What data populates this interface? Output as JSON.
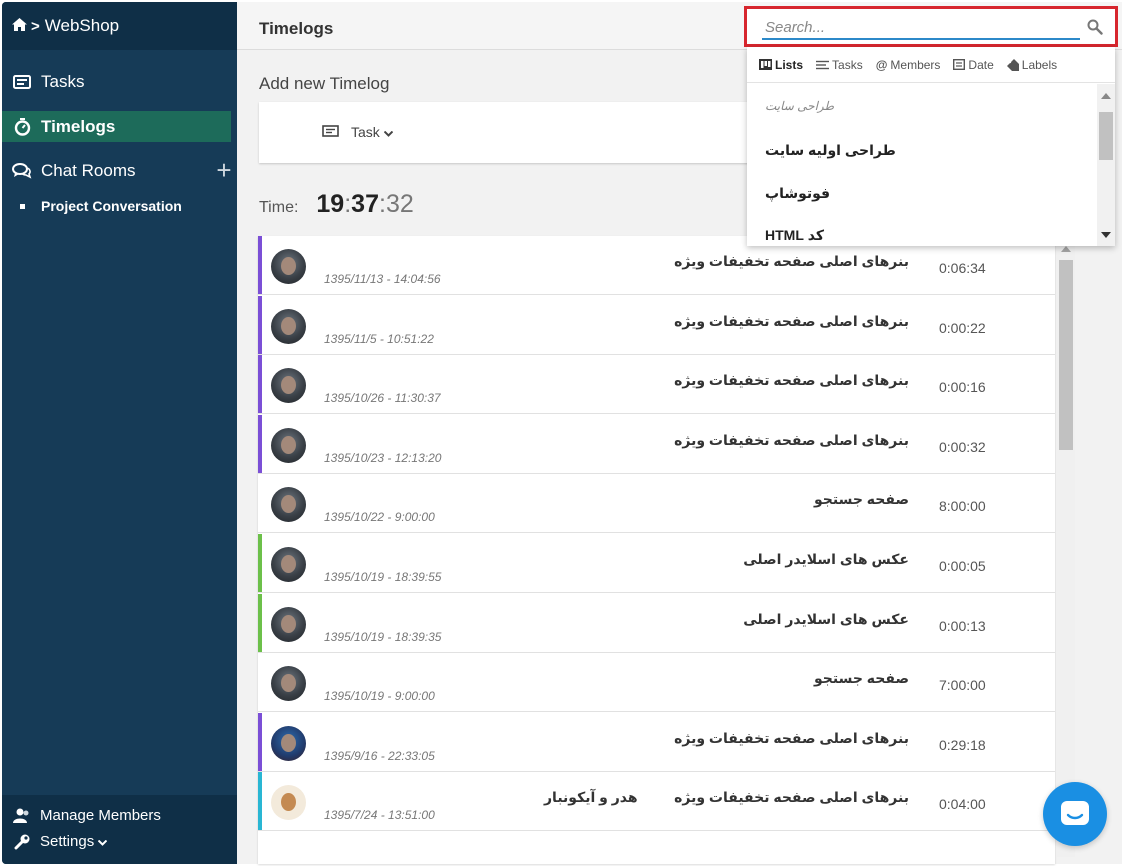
{
  "sidebar": {
    "breadcrumb": {
      "home_icon": "home-icon",
      "separator": ">",
      "project": "WebShop"
    },
    "items": [
      {
        "label": "Tasks",
        "icon": "card-icon"
      },
      {
        "label": "Timelogs",
        "icon": "stopwatch-icon"
      },
      {
        "label": "Chat Rooms",
        "icon": "chat-icon"
      }
    ],
    "chat_rooms": [
      "Project Conversation"
    ],
    "footer": {
      "manage_members": "Manage Members",
      "settings": "Settings"
    }
  },
  "header": {
    "title": "Timelogs"
  },
  "search": {
    "placeholder": "Search...",
    "filters": [
      "Lists",
      "Tasks",
      "Members",
      "Date",
      "Labels"
    ],
    "group": "طراحی سایت",
    "results": [
      "طراحی اولیه سایت",
      "فوتوشاپ",
      "کد HTML"
    ]
  },
  "add_timelog": {
    "title": "Add new Timelog",
    "task_selector": "Task"
  },
  "timer": {
    "label": "Time:",
    "hours": "19",
    "minutes": "37",
    "seconds": "32"
  },
  "timelogs": [
    {
      "date": "1395/11/13 - 14:04:56",
      "task": "بنرهای اصلی صفحه تخفیفات ویژه",
      "duration": "0:06:34",
      "bar_color": "#7b4fd6",
      "avatar": "photo"
    },
    {
      "date": "1395/11/5 - 10:51:22",
      "task": "بنرهای اصلی صفحه تخفیفات ویژه",
      "duration": "0:00:22",
      "bar_color": "#7b4fd6",
      "avatar": "photo"
    },
    {
      "date": "1395/10/26 - 11:30:37",
      "task": "بنرهای اصلی صفحه تخفیفات ویژه",
      "duration": "0:00:16",
      "bar_color": "#7b4fd6",
      "avatar": "photo"
    },
    {
      "date": "1395/10/23 - 12:13:20",
      "task": "بنرهای اصلی صفحه تخفیفات ویژه",
      "duration": "0:00:32",
      "bar_color": "#7b4fd6",
      "avatar": "photo"
    },
    {
      "date": "1395/10/22 - 9:00:00",
      "task": "صفحه جستجو",
      "duration": "8:00:00",
      "bar_color": "",
      "avatar": "photo"
    },
    {
      "date": "1395/10/19 - 18:39:55",
      "task": "عکس های اسلایدر اصلی",
      "duration": "0:00:05",
      "bar_color": "#6cc04a",
      "avatar": "photo"
    },
    {
      "date": "1395/10/19 - 18:39:35",
      "task": "عکس های اسلایدر اصلی",
      "duration": "0:00:13",
      "bar_color": "#6cc04a",
      "avatar": "photo"
    },
    {
      "date": "1395/10/19 - 9:00:00",
      "task": "صفحه جستجو",
      "duration": "7:00:00",
      "bar_color": "",
      "avatar": "photo"
    },
    {
      "date": "1395/9/16 - 22:33:05",
      "task": "بنرهای اصلی صفحه تخفیفات ویژه",
      "duration": "0:29:18",
      "bar_color": "#7b4fd6",
      "avatar": "blue"
    },
    {
      "date": "1395/7/24 - 13:51:00",
      "task": "بنرهای اصلی صفحه تخفیفات ویژه",
      "label": "هدر و آیکونبار",
      "duration": "0:04:00",
      "bar_color": "#29b6d3",
      "avatar": "sketch"
    }
  ],
  "colors": {
    "sidebar": "#163b57",
    "sidebar_dark": "#0f2f47",
    "active": "#1d6b5a",
    "highlight": "#d7262e",
    "chat": "#1a8fe3"
  }
}
